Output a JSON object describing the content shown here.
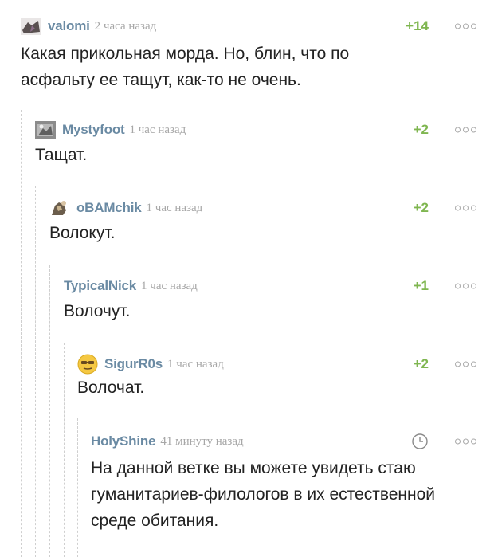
{
  "comments": [
    {
      "username": "valomi",
      "time": "2 часа назад",
      "rating": "+14",
      "text": "Какая прикольная морда. Но, блин, что по асфальту ее тащут, как-то не очень.",
      "avatar": "avatar-photo-icon"
    },
    {
      "username": "Mystyfoot",
      "time": "1 час назад",
      "rating": "+2",
      "text": "Тащат.",
      "avatar": "avatar-photo-icon"
    },
    {
      "username": "oBAMchik",
      "time": "1 час назад",
      "rating": "+2",
      "text": "Волокут.",
      "avatar": "avatar-photo-icon"
    },
    {
      "username": "TypicalNick",
      "time": "1 час назад",
      "rating": "+1",
      "text": "Волочут.",
      "avatar": ""
    },
    {
      "username": "SigurR0s",
      "time": "1 час назад",
      "rating": "+2",
      "text": "Волочат.",
      "avatar": "smiley-avatar-icon"
    },
    {
      "username": "HolyShine",
      "time": "41 минуту назад",
      "rating": "",
      "text": "На данной ветке вы можете увидеть стаю гуманитариев-филологов в их естественной среде обитания.",
      "avatar": "",
      "status_icon": "clock-icon"
    }
  ],
  "colors": {
    "username": "#6a8aa3",
    "rating": "#7fb650",
    "time": "#a7a7a7",
    "text": "#222222",
    "branch_line": "#cfcfcf"
  }
}
